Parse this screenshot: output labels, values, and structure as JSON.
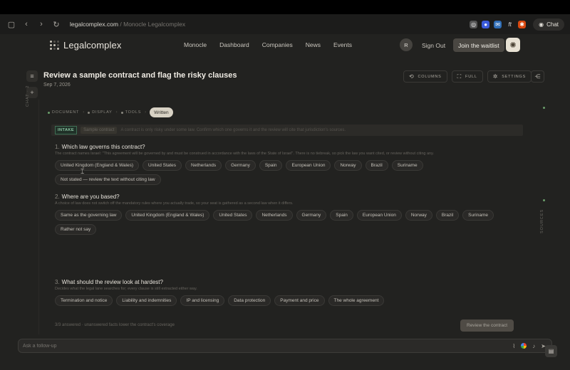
{
  "browser": {
    "url_domain": "legalcomplex.com",
    "url_separator": " / ",
    "url_path": "Monocle Legalcomplex",
    "chat_label": "Chat"
  },
  "nav": {
    "logo_text": "Legalcomplex",
    "links": [
      "Monocle",
      "Dashboard",
      "Companies",
      "News",
      "Events"
    ],
    "avatar_initial": "R",
    "sign_out": "Sign Out",
    "waitlist": "Join the waitlist"
  },
  "header": {
    "title": "Review a sample contract and flag the risky clauses",
    "date": "Sep 7, 2026",
    "buttons": {
      "columns": "COLUMNS",
      "full": "FULL",
      "settings": "SETTINGS"
    }
  },
  "rail": {
    "chat_label": "CHAT · 2",
    "sources_label": "SOURCES"
  },
  "steps": {
    "document": "DOCUMENT",
    "display": "DISPLAY",
    "tools": "TOOLS",
    "written": "Written"
  },
  "intake": {
    "tag": "INTAKE",
    "context": "Sample contract",
    "text": "A contract is only risky under some law. Confirm which one governs it and the review will cite that jurisdiction's sources."
  },
  "questions": [
    {
      "number": "1.",
      "title": "Which law governs this contract?",
      "hint": "The contract names Israel: \"This agreement will be governed by and must be construed in accordance with the laws of the State of Israel\". There is no tiebreak, so pick the law you want cited, or review without citing any.",
      "options": [
        "United Kingdom (England & Wales)",
        "United States",
        "Netherlands",
        "Germany",
        "Spain",
        "European Union",
        "Norway",
        "Brazil",
        "Suriname",
        "Not stated — review the text without citing law"
      ]
    },
    {
      "number": "2.",
      "title": "Where are you based?",
      "hint": "A choice of law does not switch off the mandatory rules where you actually trade, so your seat is gathered as a second law when it differs.",
      "options": [
        "Same as the governing law",
        "United Kingdom (England & Wales)",
        "United States",
        "Netherlands",
        "Germany",
        "Spain",
        "European Union",
        "Norway",
        "Brazil",
        "Suriname",
        "Rather not say"
      ]
    },
    {
      "number": "3.",
      "title": "What should the review look at hardest?",
      "hint": "Decides what the legal lane searches for; every clause is still extracted either way.",
      "options": [
        "Termination and notice",
        "Liability and indemnities",
        "IP and licensing",
        "Data protection",
        "Payment and price",
        "The whole agreement"
      ]
    }
  ],
  "footer": {
    "status": "3/3 answered · unanswered facts lower the contract's coverage",
    "review_button": "Review the contract"
  },
  "followup": {
    "placeholder": "Ask a follow-up"
  },
  "icons": {
    "sidebar": "sidebar-icon",
    "back": "back-icon",
    "forward": "forward-icon",
    "reload": "reload-icon",
    "menu": "menu-icon",
    "plus": "plus-icon",
    "share": "share-icon",
    "sun": "sun-icon",
    "attach": "paperclip-icon",
    "mic": "microphone-icon",
    "doc": "document-icon"
  },
  "colors": {
    "background": "#222220",
    "accent": "#d8d2c4",
    "intake_green": "#8ec9a6"
  }
}
